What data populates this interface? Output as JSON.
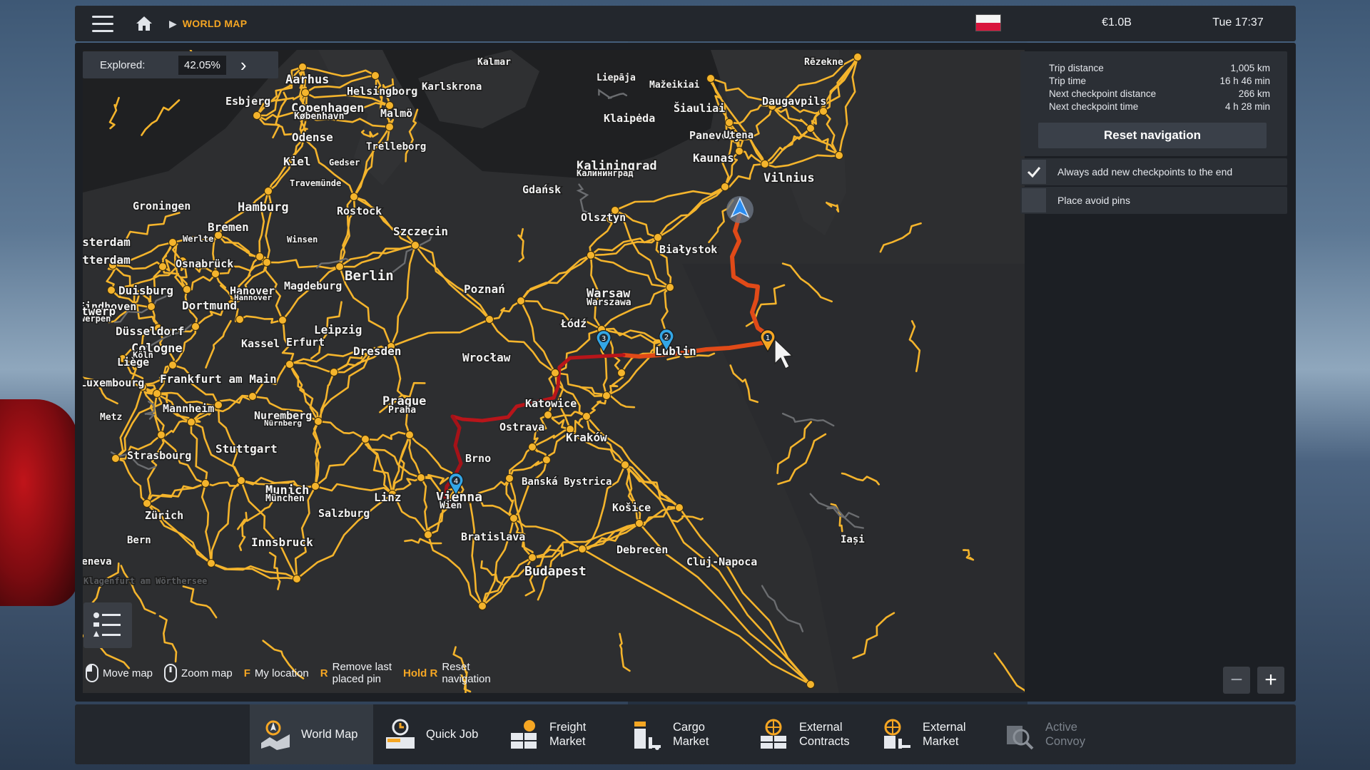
{
  "header": {
    "breadcrumb_title": "WORLD MAP",
    "money": "€1.0B",
    "clock": "Tue 17:37"
  },
  "explored": {
    "label": "Explored:",
    "value": "42.05%"
  },
  "navigation": {
    "rows": [
      {
        "label": "Trip distance",
        "value": "1,005 km"
      },
      {
        "label": "Trip time",
        "value": "16 h 46 min"
      },
      {
        "label": "Next checkpoint distance",
        "value": "266 km"
      },
      {
        "label": "Next checkpoint time",
        "value": "4 h 28 min"
      }
    ],
    "reset_label": "Reset navigation",
    "option_always_add": "Always add new checkpoints to the end",
    "option_avoid_pins": "Place avoid pins"
  },
  "hints": {
    "move_map": "Move map",
    "zoom_map": "Zoom map",
    "my_location_key": "F",
    "my_location": "My location",
    "remove_pin_key": "R",
    "remove_pin_line1": "Remove last",
    "remove_pin_line2": "placed pin",
    "reset_key": "Hold R",
    "reset_line1": "Reset",
    "reset_line2": "navigation"
  },
  "dock": [
    {
      "line1": "World Map",
      "line2": ""
    },
    {
      "line1": "Quick Job",
      "line2": ""
    },
    {
      "line1": "Freight",
      "line2": "Market"
    },
    {
      "line1": "Cargo",
      "line2": "Market"
    },
    {
      "line1": "External",
      "line2": "Contracts"
    },
    {
      "line1": "External",
      "line2": "Market"
    },
    {
      "line1": "Active",
      "line2": "Convoy"
    }
  ],
  "map_cities": [
    {
      "name": "Kalmar"
    },
    {
      "name": "Aarhus"
    },
    {
      "name": "Helsingborg"
    },
    {
      "name": "Karlskrona"
    },
    {
      "name": "Esbjerg"
    },
    {
      "name": "Copenhagen"
    },
    {
      "name": "København"
    },
    {
      "name": "Malmö"
    },
    {
      "name": "Odense"
    },
    {
      "name": "Trelleborg"
    },
    {
      "name": "Kiel"
    },
    {
      "name": "Gedser"
    },
    {
      "name": "Travemünde"
    },
    {
      "name": "Rostock"
    },
    {
      "name": "Groningen"
    },
    {
      "name": "Hamburg"
    },
    {
      "name": "Bremen"
    },
    {
      "name": "Werlte"
    },
    {
      "name": "Winsen"
    },
    {
      "name": "Amsterdam"
    },
    {
      "name": "Rotterdam"
    },
    {
      "name": "Osnabrück"
    },
    {
      "name": "Szczecin"
    },
    {
      "name": "Berlin"
    },
    {
      "name": "Duisburg"
    },
    {
      "name": "Hanover"
    },
    {
      "name": "Hannover"
    },
    {
      "name": "Magdeburg"
    },
    {
      "name": "Eindhoven"
    },
    {
      "name": "Dortmund"
    },
    {
      "name": "twerp"
    },
    {
      "name": "werpen"
    },
    {
      "name": "Düsseldorf"
    },
    {
      "name": "Leipzig"
    },
    {
      "name": "Kassel"
    },
    {
      "name": "Erfurt"
    },
    {
      "name": "Cologne"
    },
    {
      "name": "Köln"
    },
    {
      "name": "Dresden"
    },
    {
      "name": "Liège"
    },
    {
      "name": "Frankfurt am Main"
    },
    {
      "name": "Luxembourg"
    },
    {
      "name": "Mannheim"
    },
    {
      "name": "Nuremberg"
    },
    {
      "name": "Nürnberg"
    },
    {
      "name": "Metz"
    },
    {
      "name": "Stuttgart"
    },
    {
      "name": "Strasbourg"
    },
    {
      "name": "Prague"
    },
    {
      "name": "Praha"
    },
    {
      "name": "Munich"
    },
    {
      "name": "München"
    },
    {
      "name": "Zürich"
    },
    {
      "name": "Salzburg"
    },
    {
      "name": "Linz"
    },
    {
      "name": "Bern"
    },
    {
      "name": "Innsbruck"
    },
    {
      "name": "Geneva"
    },
    {
      "name": "Vienna"
    },
    {
      "name": "Wien"
    },
    {
      "name": "Bratislava"
    },
    {
      "name": "Brno"
    },
    {
      "name": "Ostrava"
    },
    {
      "name": "Katowice"
    },
    {
      "name": "Kraków"
    },
    {
      "name": "Wrocław"
    },
    {
      "name": "Poznań"
    },
    {
      "name": "Łódź"
    },
    {
      "name": "Warsaw"
    },
    {
      "name": "Warszawa"
    },
    {
      "name": "Lublin"
    },
    {
      "name": "Olsztyn"
    },
    {
      "name": "Gdańsk"
    },
    {
      "name": "Białystok"
    },
    {
      "name": "Kaliningrad"
    },
    {
      "name": "Калининград"
    },
    {
      "name": "Liepāja"
    },
    {
      "name": "Mažeikiai"
    },
    {
      "name": "Šiauliai"
    },
    {
      "name": "Klaipėda"
    },
    {
      "name": "Panevėžys"
    },
    {
      "name": "Utena"
    },
    {
      "name": "Kaunas"
    },
    {
      "name": "Vilnius"
    },
    {
      "name": "Daugavpils"
    },
    {
      "name": "Rēzekne"
    },
    {
      "name": "Banská Bystrica"
    },
    {
      "name": "Košice"
    },
    {
      "name": "Debrecen"
    },
    {
      "name": "Budapest"
    },
    {
      "name": "Cluj-Napoca"
    },
    {
      "name": "Iași"
    },
    {
      "name": "Klagenfurt am Wörthersee"
    }
  ],
  "route_pins": [
    "1",
    "2",
    "3",
    "4"
  ],
  "colors": {
    "road": "#f4b42c",
    "route": "#d63a16",
    "accent": "#f5a623",
    "land": "#2b2c2e"
  }
}
